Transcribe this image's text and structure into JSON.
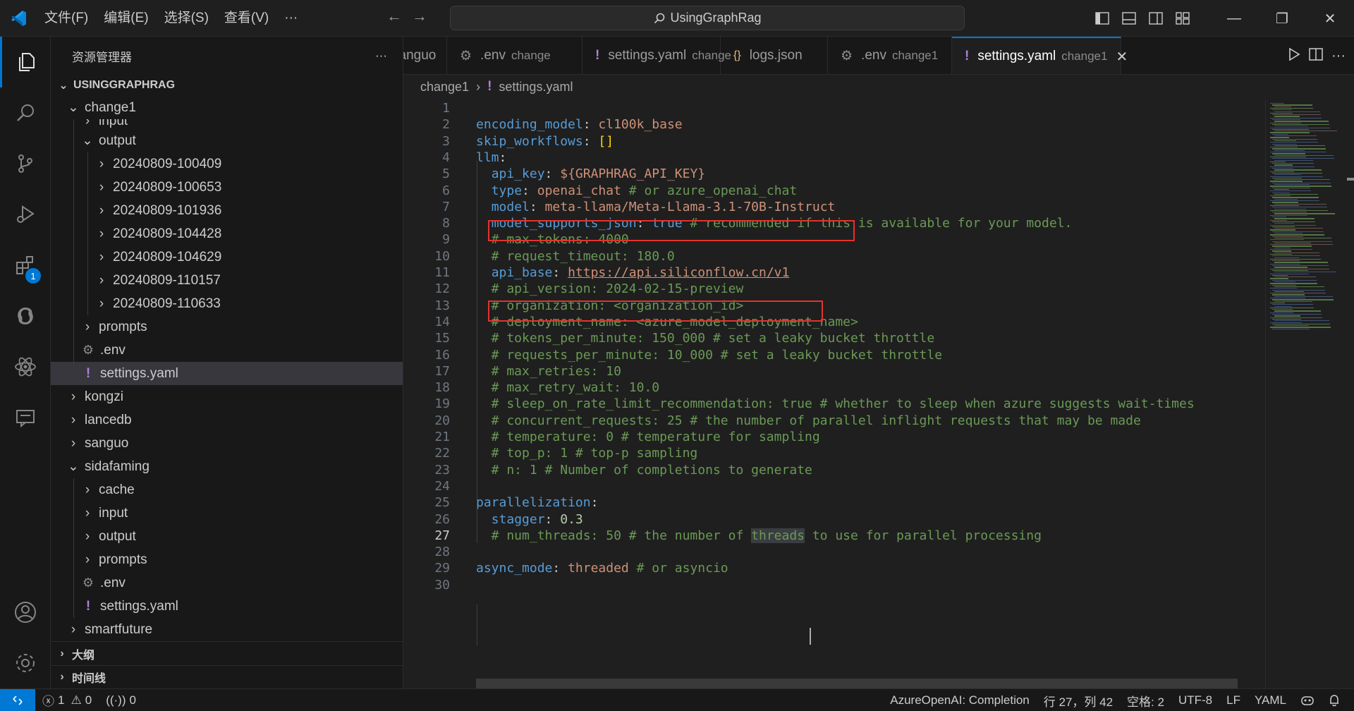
{
  "titlebar": {
    "menu": [
      "文件(F)",
      "编辑(E)",
      "选择(S)",
      "查看(V)",
      "···"
    ],
    "search_text": "UsingGraphRag"
  },
  "activity_bar": {
    "extensions_badge": "1"
  },
  "sidebar": {
    "title": "资源管理器",
    "more": "···",
    "root": "USINGGRAPHRAG",
    "tree": [
      {
        "label": "change1",
        "depth": 0,
        "chev": "down"
      },
      {
        "label": "input",
        "depth": 1,
        "chev": "right"
      },
      {
        "label": "output",
        "depth": 1,
        "chev": "down"
      },
      {
        "label": "20240809-100409",
        "depth": 2,
        "chev": "right"
      },
      {
        "label": "20240809-100653",
        "depth": 2,
        "chev": "right"
      },
      {
        "label": "20240809-101936",
        "depth": 2,
        "chev": "right"
      },
      {
        "label": "20240809-104428",
        "depth": 2,
        "chev": "right"
      },
      {
        "label": "20240809-104629",
        "depth": 2,
        "chev": "right"
      },
      {
        "label": "20240809-110157",
        "depth": 2,
        "chev": "right"
      },
      {
        "label": "20240809-110633",
        "depth": 2,
        "chev": "right"
      },
      {
        "label": "prompts",
        "depth": 1,
        "chev": "right"
      },
      {
        "label": ".env",
        "depth": 1,
        "icon": "gear"
      },
      {
        "label": "settings.yaml",
        "depth": 1,
        "icon": "bang",
        "selected": true
      },
      {
        "label": "kongzi",
        "depth": 0,
        "chev": "right"
      },
      {
        "label": "lancedb",
        "depth": 0,
        "chev": "right"
      },
      {
        "label": "sanguo",
        "depth": 0,
        "chev": "right"
      },
      {
        "label": "sidafaming",
        "depth": 0,
        "chev": "down"
      },
      {
        "label": "cache",
        "depth": 1,
        "chev": "right"
      },
      {
        "label": "input",
        "depth": 1,
        "chev": "right"
      },
      {
        "label": "output",
        "depth": 1,
        "chev": "right"
      },
      {
        "label": "prompts",
        "depth": 1,
        "chev": "right"
      },
      {
        "label": ".env",
        "depth": 1,
        "icon": "gear"
      },
      {
        "label": "settings.yaml",
        "depth": 1,
        "icon": "bang"
      },
      {
        "label": "smartfuture",
        "depth": 0,
        "chev": "right"
      }
    ],
    "outline": "大纲",
    "timeline": "时间线"
  },
  "tabs": [
    {
      "label": "sanguo",
      "desc": "",
      "icon": "none"
    },
    {
      "label": ".env",
      "desc": "change",
      "icon": "gear"
    },
    {
      "label": "settings.yaml",
      "desc": "change",
      "icon": "bang"
    },
    {
      "label": "logs.json",
      "desc": "",
      "icon": "braces"
    },
    {
      "label": ".env",
      "desc": "change1",
      "icon": "gear"
    },
    {
      "label": "settings.yaml",
      "desc": "change1",
      "icon": "bang",
      "active": true
    }
  ],
  "breadcrumb": {
    "folder": "change1",
    "file": "settings.yaml"
  },
  "editor": {
    "current_line": 27,
    "lines": [
      [],
      [
        [
          "k",
          "encoding_model"
        ],
        [
          "p",
          ": "
        ],
        [
          "s",
          "cl100k_base"
        ]
      ],
      [
        [
          "k",
          "skip_workflows"
        ],
        [
          "p",
          ": "
        ],
        [
          "y",
          "[]"
        ]
      ],
      [
        [
          "k",
          "llm"
        ],
        [
          "p",
          ":"
        ]
      ],
      [
        [
          "p",
          "  "
        ],
        [
          "k",
          "api_key"
        ],
        [
          "p",
          ": "
        ],
        [
          "s",
          "${GRAPHRAG_API_KEY}"
        ]
      ],
      [
        [
          "p",
          "  "
        ],
        [
          "k",
          "type"
        ],
        [
          "p",
          ": "
        ],
        [
          "s",
          "openai_chat"
        ],
        [
          "c",
          " # or azure_openai_chat"
        ]
      ],
      [
        [
          "p",
          "  "
        ],
        [
          "k",
          "model"
        ],
        [
          "p",
          ": "
        ],
        [
          "s",
          "meta-llama/Meta-Llama-3.1-70B-Instruct"
        ]
      ],
      [
        [
          "p",
          "  "
        ],
        [
          "k",
          "model_supports_json"
        ],
        [
          "p",
          ": "
        ],
        [
          "k",
          "true"
        ],
        [
          "c",
          " # recommended if this is available for your model."
        ]
      ],
      [
        [
          "c",
          "  # max_tokens: 4000"
        ]
      ],
      [
        [
          "c",
          "  # request_timeout: 180.0"
        ]
      ],
      [
        [
          "p",
          "  "
        ],
        [
          "k",
          "api_base"
        ],
        [
          "p",
          ": "
        ],
        [
          "u",
          "https://api.siliconflow.cn/v1"
        ]
      ],
      [
        [
          "c",
          "  # api_version: 2024-02-15-preview"
        ]
      ],
      [
        [
          "c",
          "  # organization: <organization_id>"
        ]
      ],
      [
        [
          "c",
          "  # deployment_name: <azure_model_deployment_name>"
        ]
      ],
      [
        [
          "c",
          "  # tokens_per_minute: 150_000 # set a leaky bucket throttle"
        ]
      ],
      [
        [
          "c",
          "  # requests_per_minute: 10_000 # set a leaky bucket throttle"
        ]
      ],
      [
        [
          "c",
          "  # max_retries: 10"
        ]
      ],
      [
        [
          "c",
          "  # max_retry_wait: 10.0"
        ]
      ],
      [
        [
          "c",
          "  # sleep_on_rate_limit_recommendation: true # whether to sleep when azure suggests wait-times"
        ]
      ],
      [
        [
          "c",
          "  # concurrent_requests: 25 # the number of parallel inflight requests that may be made"
        ]
      ],
      [
        [
          "c",
          "  # temperature: 0 # temperature for sampling"
        ]
      ],
      [
        [
          "c",
          "  # top_p: 1 # top-p sampling"
        ]
      ],
      [
        [
          "c",
          "  # n: 1 # Number of completions to generate"
        ]
      ],
      [],
      [
        [
          "k",
          "parallelization"
        ],
        [
          "p",
          ":"
        ]
      ],
      [
        [
          "p",
          "  "
        ],
        [
          "k",
          "stagger"
        ],
        [
          "p",
          ": "
        ],
        [
          "n",
          "0.3"
        ]
      ],
      [
        [
          "c",
          "  # num_threads: 50 # the number of "
        ],
        [
          "h",
          "threads"
        ],
        [
          "c",
          " to use for parallel processing"
        ]
      ],
      [],
      [
        [
          "k",
          "async_mode"
        ],
        [
          "p",
          ": "
        ],
        [
          "s",
          "threaded"
        ],
        [
          "c",
          " # or asyncio"
        ]
      ],
      []
    ]
  },
  "statusbar": {
    "errors": "1",
    "warnings": "0",
    "ports": "0",
    "mode": "AzureOpenAI: Completion",
    "position": "行 27，列 42",
    "spaces": "空格: 2",
    "encoding": "UTF-8",
    "eol": "LF",
    "language": "YAML"
  }
}
